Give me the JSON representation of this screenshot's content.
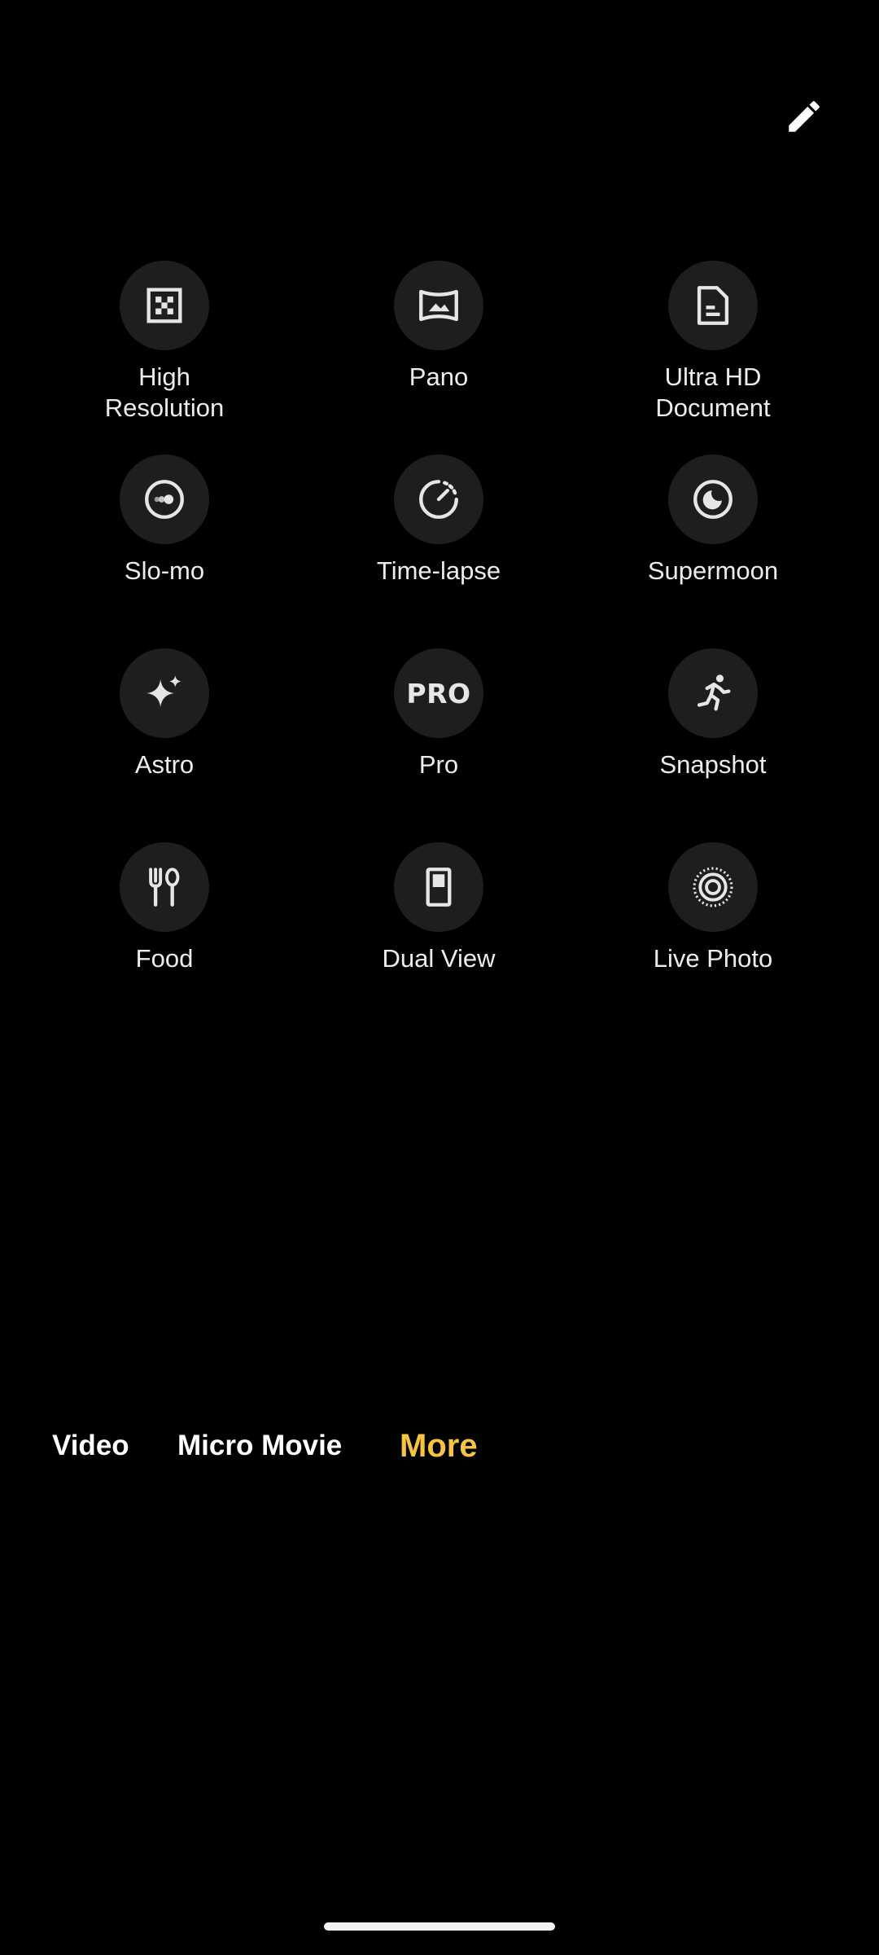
{
  "header": {
    "edit_icon": "pencil-icon"
  },
  "modes": [
    [
      {
        "label": "High\nResolution",
        "icon": "high-resolution-icon"
      },
      {
        "label": "Pano",
        "icon": "pano-icon"
      },
      {
        "label": "Ultra HD\nDocument",
        "icon": "document-icon"
      }
    ],
    [
      {
        "label": "Slo-mo",
        "icon": "slo-mo-icon"
      },
      {
        "label": "Time-lapse",
        "icon": "time-lapse-icon"
      },
      {
        "label": "Supermoon",
        "icon": "supermoon-icon"
      }
    ],
    [
      {
        "label": "Astro",
        "icon": "sparkle-icon"
      },
      {
        "label": "Pro",
        "icon": "pro-icon",
        "icon_text": "PRO"
      },
      {
        "label": "Snapshot",
        "icon": "running-person-icon"
      }
    ],
    [
      {
        "label": "Food",
        "icon": "fork-spoon-icon"
      },
      {
        "label": "Dual View",
        "icon": "dual-view-icon"
      },
      {
        "label": "Live Photo",
        "icon": "live-photo-icon"
      }
    ]
  ],
  "mode_bar": {
    "tabs": [
      {
        "label": "Video"
      },
      {
        "label": "Micro Movie"
      },
      {
        "label": "More",
        "active": true
      }
    ],
    "active_color": "#f5c542"
  },
  "colors": {
    "background": "#000000",
    "icon_circle": "#1e1e1e",
    "text": "#ececec"
  }
}
